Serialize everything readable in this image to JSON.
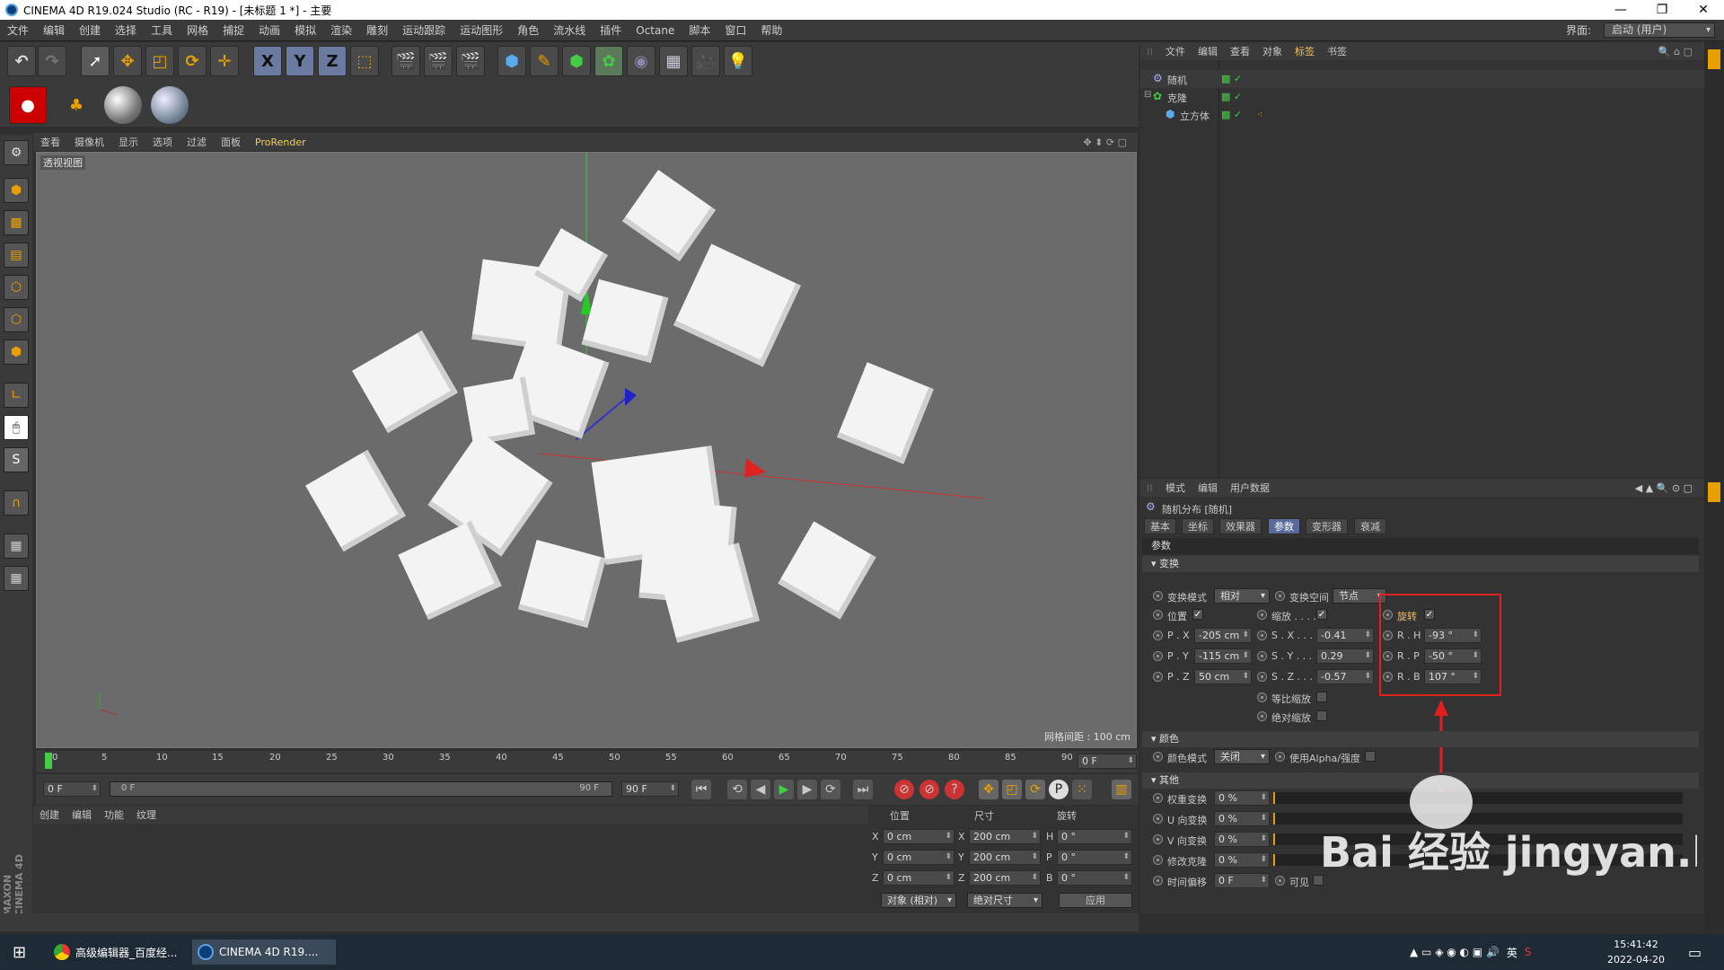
{
  "window": {
    "title": "CINEMA 4D R19.024 Studio (RC - R19) - [未标题 1 *] - 主要"
  },
  "menu": [
    "文件",
    "编辑",
    "创建",
    "选择",
    "工具",
    "网格",
    "捕捉",
    "动画",
    "模拟",
    "渲染",
    "雕刻",
    "运动跟踪",
    "运动图形",
    "角色",
    "流水线",
    "插件",
    "Octane",
    "脚本",
    "窗口",
    "帮助"
  ],
  "layout": {
    "label": "界面:",
    "value": "启动 (用户)"
  },
  "toolbar": {
    "x": "X",
    "y": "Y",
    "z": "Z"
  },
  "viewport": {
    "menu": [
      "查看",
      "摄像机",
      "显示",
      "选项",
      "过滤",
      "面板",
      "ProRender"
    ],
    "label": "透视视图",
    "grid_spacing": "网格间距 : 100 cm"
  },
  "timeline": {
    "ticks": [
      "0",
      "5",
      "10",
      "15",
      "20",
      "25",
      "30",
      "35",
      "40",
      "45",
      "50",
      "55",
      "60",
      "65",
      "70",
      "75",
      "80",
      "85",
      "90"
    ],
    "current": "0 F",
    "start": "0 F",
    "slider_left": "0 F",
    "slider_right": "90 F",
    "end": "90 F"
  },
  "material": {
    "menu": [
      "创建",
      "编辑",
      "功能",
      "纹理"
    ]
  },
  "coords": {
    "headers": {
      "pos": "位置",
      "size": "尺寸",
      "rot": "旋转"
    },
    "rows": [
      {
        "a": "X",
        "pos": "0 cm",
        "s": "X",
        "size": "200 cm",
        "r": "H",
        "rot": "0 °"
      },
      {
        "a": "Y",
        "pos": "0 cm",
        "s": "Y",
        "size": "200 cm",
        "r": "P",
        "rot": "0 °"
      },
      {
        "a": "Z",
        "pos": "0 cm",
        "s": "Z",
        "size": "200 cm",
        "r": "B",
        "rot": "0 °"
      }
    ],
    "mode": "对象 (相对)",
    "size_mode": "绝对尺寸",
    "apply": "应用"
  },
  "objects": {
    "menu": [
      "文件",
      "编辑",
      "查看",
      "对象",
      "标签",
      "书签"
    ],
    "items": [
      {
        "name": "随机",
        "color": "#f0a030"
      },
      {
        "name": "克隆",
        "color": "#c8c8c8"
      },
      {
        "name": "立方体",
        "color": "#c8c8c8"
      }
    ]
  },
  "attributes": {
    "menu": [
      "模式",
      "编辑",
      "用户数据"
    ],
    "object_title": "随机分布 [随机]",
    "tabs": [
      "基本",
      "坐标",
      "效果器",
      "参数",
      "变形器",
      "衰减"
    ],
    "active_tab": "参数",
    "section_params": "参数",
    "section_transform": "变换",
    "transform_mode_label": "变换模式",
    "transform_mode": "相对",
    "transform_space_label": "变换空间",
    "transform_space": "节点",
    "position": "位置",
    "scale": "缩放 . . . .",
    "rotation": "旋转",
    "px": {
      "label": "P . X",
      "value": "-205 cm"
    },
    "py": {
      "label": "P . Y",
      "value": "-115 cm"
    },
    "pz": {
      "label": "P . Z",
      "value": "50 cm"
    },
    "sx": {
      "label": "S . X . . .",
      "value": "-0.41"
    },
    "sy": {
      "label": "S . Y . . .",
      "value": "0.29"
    },
    "sz": {
      "label": "S . Z . . .",
      "value": "-0.57"
    },
    "rh": {
      "label": "R . H",
      "value": "-93 °"
    },
    "rp": {
      "label": "R . P",
      "value": "-50 °"
    },
    "rb": {
      "label": "R . B",
      "value": "107 °"
    },
    "uniform_scale": "等比缩放",
    "absolute_scale": "绝对缩放",
    "section_color": "颜色",
    "color_mode_label": "颜色模式",
    "color_mode": "关闭",
    "use_alpha": "使用Alpha/强度",
    "section_other": "其他",
    "weight": {
      "label": "权重变换",
      "value": "0 %"
    },
    "u": {
      "label": "U 向变换",
      "value": "0 %"
    },
    "v": {
      "label": "V 向变换",
      "value": "0 %"
    },
    "modify": {
      "label": "修改克隆",
      "value": "0 %"
    },
    "time_offset": {
      "label": "时间偏移",
      "value": "0 F"
    },
    "visible": "可见"
  },
  "taskbar": {
    "apps": [
      "高级编辑器_百度经...",
      "CINEMA 4D R19...."
    ],
    "ime": "英",
    "time": "15:41:42",
    "date": "2022-04-20"
  },
  "watermark": "Bai 经验 jingyan.baidu.com",
  "colors": {
    "accent": "#e8a000",
    "highlight_box": "#e02020",
    "active_tab": "#5a6a9a"
  }
}
